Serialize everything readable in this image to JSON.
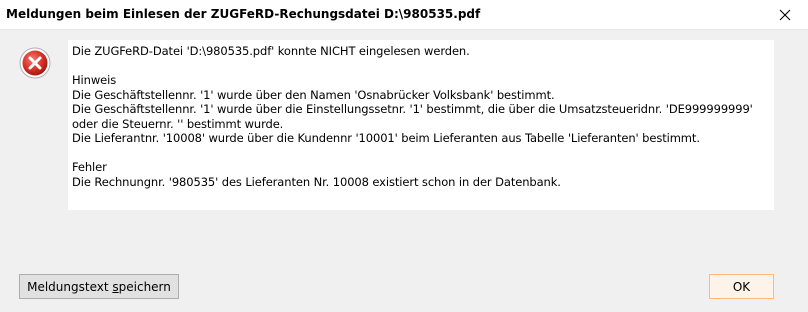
{
  "window": {
    "title": "Meldungen beim Einlesen der ZUGFeRD-Rechungsdatei D:\\980535.pdf",
    "close_icon": "close-icon"
  },
  "icon": {
    "name": "error-icon",
    "color": "#d9342b"
  },
  "message": {
    "lines": [
      "Die ZUGFeRD-Datei 'D:\\980535.pdf' konnte NICHT eingelesen werden.",
      "",
      "Hinweis",
      "Die Geschäftstellennr. '1' wurde über den Namen 'Osnabrücker Volksbank' bestimmt.",
      "Die Geschäftstellennr. '1' wurde über die Einstellungssetnr. '1' bestimmt, die über die Umsatzsteueridnr. 'DE999999999'",
      "oder die Steuernr. '' bestimmt wurde.",
      "Die Lieferantnr. '10008' wurde über die Kundennr '10001' beim Lieferanten aus Tabelle 'Lieferanten' bestimmt.",
      "",
      "Fehler",
      "Die Rechnungnr. '980535' des Lieferanten Nr. 10008 existiert schon in der Datenbank."
    ]
  },
  "buttons": {
    "save_prefix": "Meldungstext ",
    "save_mnemonic": "s",
    "save_suffix": "peichern",
    "ok_label": "OK"
  },
  "colors": {
    "ok_border": "#ffb97b",
    "dialog_bg": "#f0f0f0"
  }
}
